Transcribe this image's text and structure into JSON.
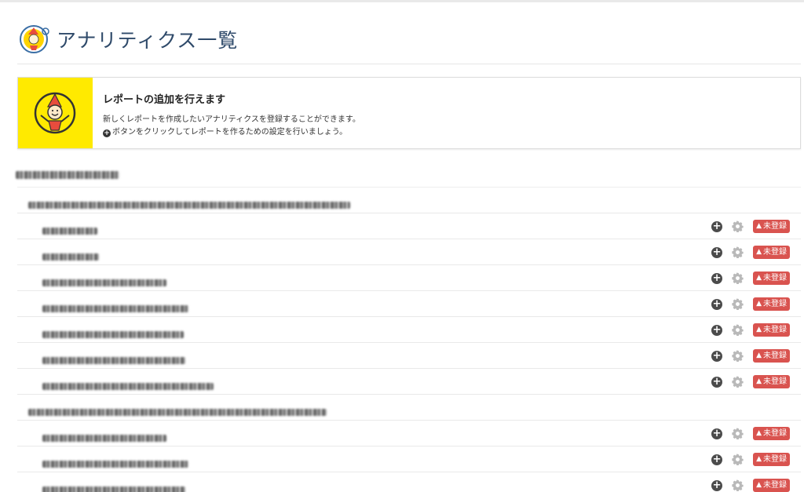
{
  "page": {
    "title": "アナリティクス一覧"
  },
  "notice": {
    "title": "レポートの追加を行えます",
    "line1": "新しくレポートを作成したいアナリティクスを登録することができます。",
    "line2": "ボタンをクリックしてレポートを作るための設定を行いましょう。"
  },
  "status": {
    "unregistered": "未登録"
  },
  "colors": {
    "title": "#2f4a6a",
    "badge": "#d9534f",
    "notice_bg": "#ffea00"
  },
  "icons": {
    "add": "plus-circle-icon",
    "settings": "gear-icon",
    "warning": "warning-icon"
  },
  "redacted": "account, property and view names are blurred and unreadable in the screenshot"
}
